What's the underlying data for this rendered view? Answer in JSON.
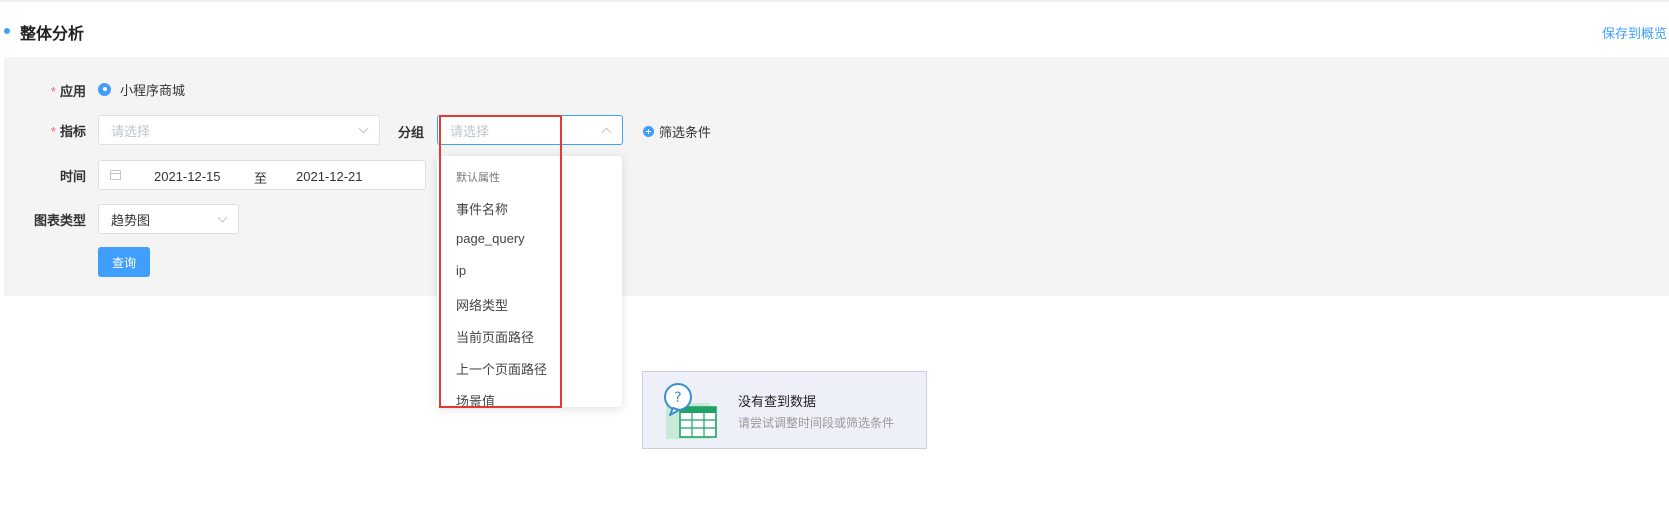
{
  "header": {
    "title": "整体分析",
    "save_link": "保存到概览"
  },
  "form": {
    "app": {
      "label": "应用",
      "required_mark": "*",
      "option": "小程序商城"
    },
    "metric": {
      "label": "指标",
      "required_mark": "*",
      "placeholder": "请选择"
    },
    "group": {
      "label": "分组",
      "placeholder": "请选择"
    },
    "filter_condition": "筛选条件",
    "time": {
      "label": "时间",
      "start": "2021-12-15",
      "separator": "至",
      "end": "2021-12-21"
    },
    "chart_type": {
      "label": "图表类型",
      "value": "趋势图"
    },
    "query_button": "查询"
  },
  "dropdown": {
    "group_title": "默认属性",
    "items": [
      "事件名称",
      "page_query",
      "ip",
      "网络类型",
      "当前页面路径",
      "上一个页面路径",
      "场景值"
    ]
  },
  "empty_state": {
    "title": "没有查到数据",
    "subtitle": "请尝试调整时间段或筛选条件"
  },
  "colors": {
    "primary": "#409eff",
    "panel_bg": "#f4f4f4",
    "highlight": "#e53935",
    "empty_bg": "#eef0f9"
  }
}
